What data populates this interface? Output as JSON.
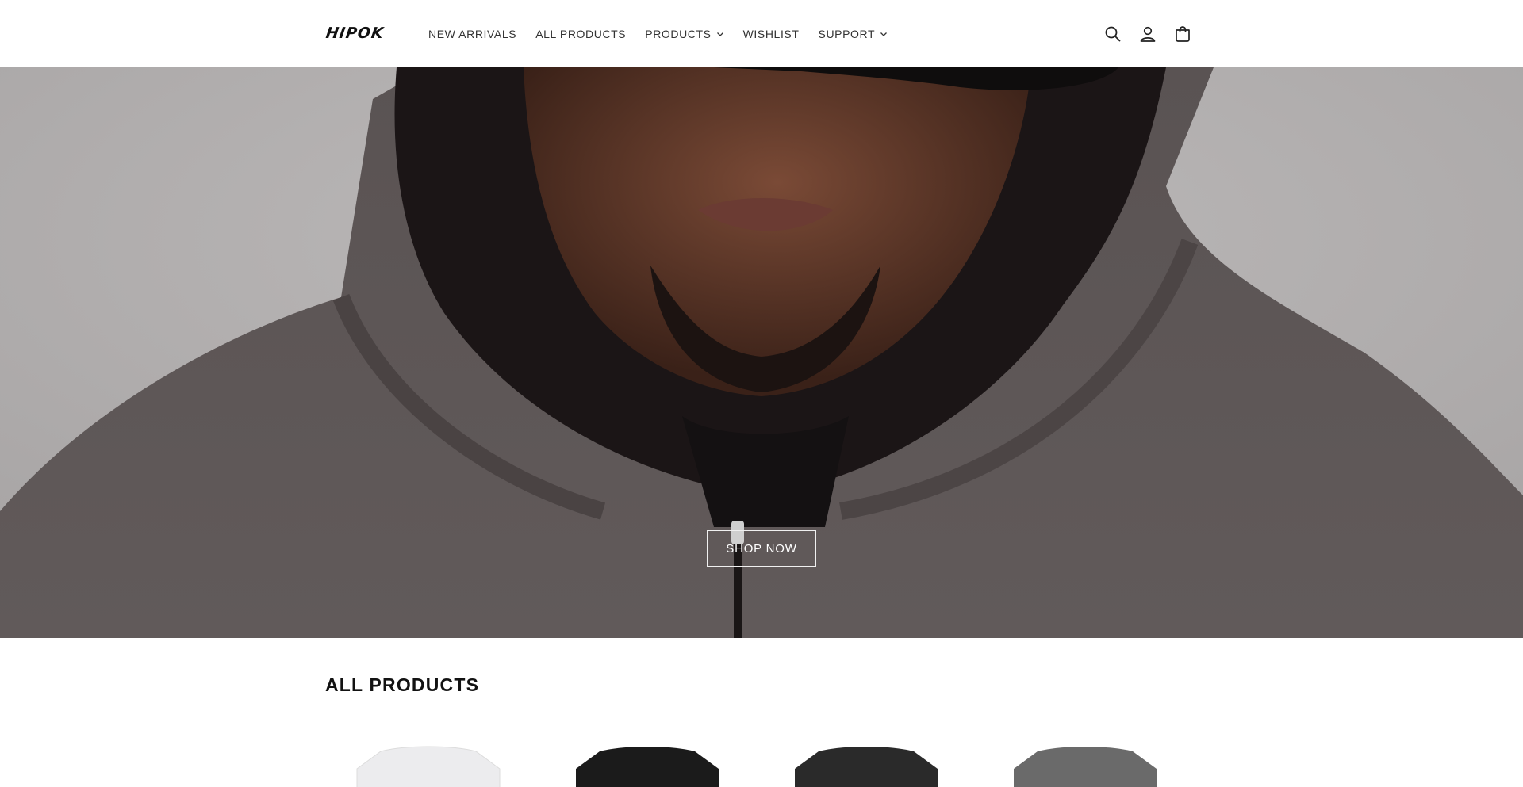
{
  "header": {
    "logo_text": "HIPOK",
    "nav": [
      {
        "label": "NEW ARRIVALS",
        "has_dropdown": false
      },
      {
        "label": "ALL PRODUCTS",
        "has_dropdown": false
      },
      {
        "label": "PRODUCTS",
        "has_dropdown": true
      },
      {
        "label": "WISHLIST",
        "has_dropdown": false
      },
      {
        "label": "SUPPORT",
        "has_dropdown": true
      }
    ],
    "icons": [
      "search-icon",
      "account-icon",
      "cart-icon"
    ]
  },
  "hero": {
    "button_label": "SHOP NOW"
  },
  "products": {
    "title": "ALL PRODUCTS",
    "items": [
      {
        "color": "#ececee"
      },
      {
        "color": "#1b1b1b"
      },
      {
        "color": "#2a2a2a"
      },
      {
        "color": "#6a6a6a"
      }
    ]
  },
  "colors": {
    "accent": "#121212",
    "header_bg": "#ffffff",
    "hoodie": "#5d5656"
  }
}
